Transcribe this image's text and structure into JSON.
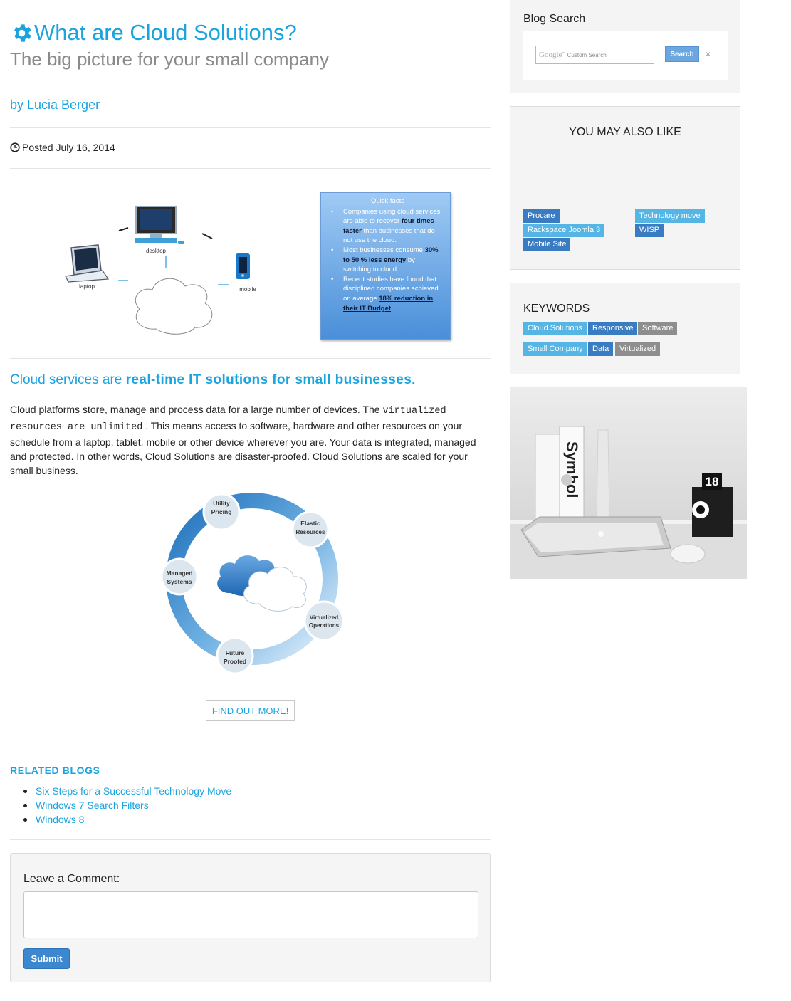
{
  "article": {
    "title": "What are Cloud Solutions?",
    "subtitle": "The big picture for your small company",
    "author": "by Lucia Berger",
    "posted": "Posted July 16, 2014"
  },
  "diagram1": {
    "labels": {
      "desktop": "desktop",
      "laptop": "laptop",
      "mobile": "mobile"
    }
  },
  "quick_facts": {
    "title": "Quick facts",
    "items": [
      {
        "pre": "Companies using cloud services are able to recover ",
        "bold": "four times faster",
        "post": " than businesses that do not use the cloud."
      },
      {
        "pre": "Most businesses consume ",
        "bold": "30% to 50 % less energy",
        "post": " by switching to cloud"
      },
      {
        "pre": "Recent studies have found that disciplined companies achieved on average ",
        "bold": "18% reduction in their IT Budget",
        "post": ""
      }
    ]
  },
  "lead": {
    "plain": "Cloud services are ",
    "bold": "real-time IT solutions for small businesses."
  },
  "body": {
    "part1": "Cloud platforms store, manage and process data for a large number of devices. The ",
    "mono": "virtualized resources are unlimited",
    "part2": " . This means access to software, hardware and other resources on your schedule from a laptop, tablet, mobile or other device wherever you are. Your data is integrated, managed and protected. In other words, Cloud Solutions are disaster-proofed. Cloud Solutions are scaled for your small business."
  },
  "diagram2": {
    "nodes": [
      {
        "l1": "Utility",
        "l2": "Pricing"
      },
      {
        "l1": "Elastic",
        "l2": "Resources"
      },
      {
        "l1": "Managed",
        "l2": "Systems"
      },
      {
        "l1": "Virtualized",
        "l2": "Operations"
      },
      {
        "l1": "Future",
        "l2": "Proofed"
      }
    ]
  },
  "cta": {
    "label": "FIND OUT MORE!"
  },
  "related": {
    "title": "RELATED BLOGS",
    "items": [
      "Six Steps for a Successful Technology Move",
      "Windows 7 Search Filters",
      "Windows 8"
    ]
  },
  "comment": {
    "label": "Leave a Comment:",
    "value": "",
    "submit": "Submit"
  },
  "sidebar": {
    "search": {
      "title": "Blog Search",
      "brand": "Google",
      "tm": "™",
      "placeholder": "Custom Search",
      "button": "Search",
      "clear": "×"
    },
    "also_like": {
      "title": "YOU MAY ALSO LIKE",
      "tags": [
        "Procare",
        "Technology move",
        "Rackspace Joomla 3",
        "WISP",
        "Mobile Site"
      ]
    },
    "keywords": {
      "title": "KEYWORDS",
      "tags": [
        "Cloud Solutions",
        "Responsive",
        "Software",
        "Small Company",
        "Data",
        "Virtualized"
      ]
    },
    "photo": {
      "book": "Symbol",
      "clock": "18"
    }
  },
  "colors": {
    "accent": "#1ba3de",
    "tag_light": "#55b5e4",
    "tag_dark": "#3a7cc2",
    "tag_gray": "#8e8e8e",
    "button": "#3b88d0"
  }
}
